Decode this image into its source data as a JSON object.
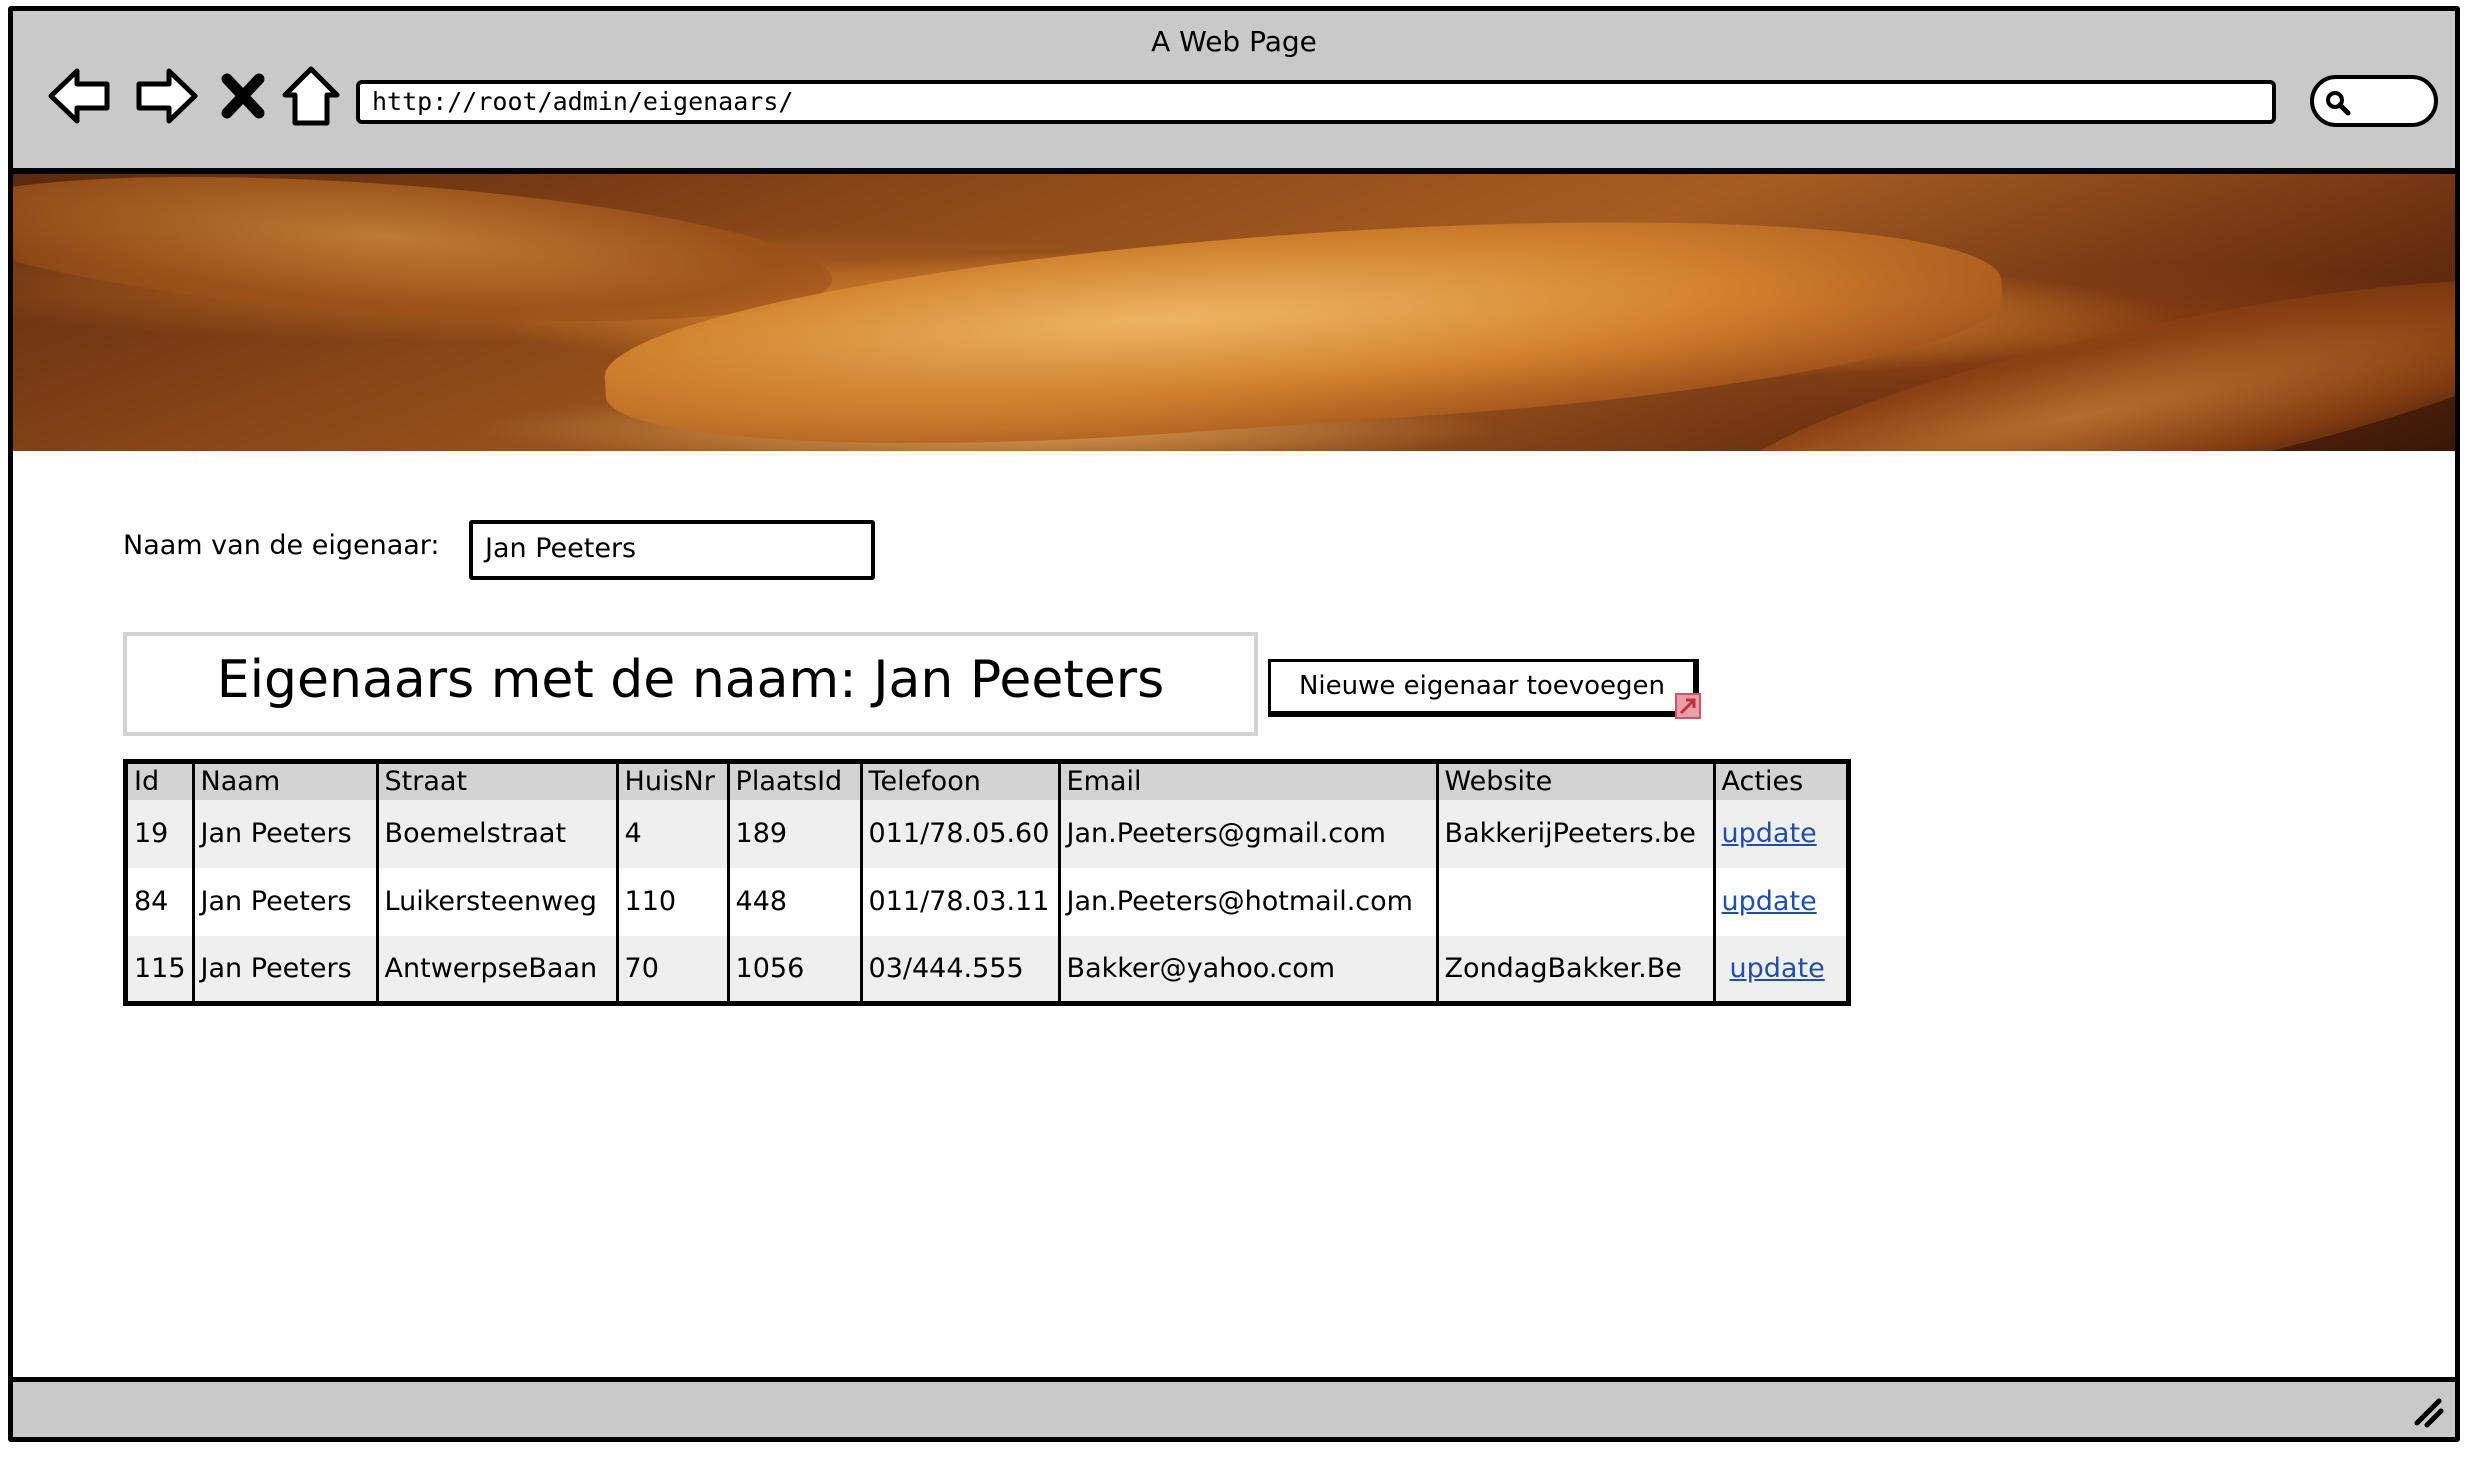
{
  "window": {
    "title": "A Web Page"
  },
  "browser": {
    "url": "http://root/admin/eigenaars/",
    "icons": [
      "back-icon",
      "forward-icon",
      "stop-icon",
      "home-icon",
      "search-icon"
    ]
  },
  "form": {
    "naam_label": "Naam van de eigenaar:",
    "naam_value": "Jan Peeters"
  },
  "heading": "Eigenaars met de naam: Jan Peeters",
  "new_button_label": "Nieuwe eigenaar toevoegen",
  "table": {
    "columns": [
      "Id",
      "Naam",
      "Straat",
      "HuisNr",
      "PlaatsId",
      "Telefoon",
      "Email",
      "Website",
      "Acties"
    ],
    "rows": [
      {
        "id": "19",
        "naam": "Jan Peeters",
        "straat": "Boemelstraat",
        "huisnr": "4",
        "plaatsid": "189",
        "telefoon": "011/78.05.60",
        "email": "Jan.Peeters@gmail.com",
        "website": "BakkerijPeeters.be",
        "actie": "update"
      },
      {
        "id": "84",
        "naam": "Jan Peeters",
        "straat": "Luikersteenweg",
        "huisnr": "110",
        "plaatsid": "448",
        "telefoon": "011/78.03.11",
        "email": "Jan.Peeters@hotmail.com",
        "website": "",
        "actie": "update"
      },
      {
        "id": "115",
        "naam": "Jan Peeters",
        "straat": "AntwerpseBaan",
        "huisnr": "70",
        "plaatsid": "1056",
        "telefoon": "03/444.555",
        "email": "Bakker@yahoo.com",
        "website": "ZondagBakker.Be",
        "actie": "update"
      }
    ]
  },
  "colors": {
    "chrome": "#c9c9c9",
    "header_row": "#d3d3d3",
    "alt_row": "#efefef",
    "link": "#1f4fa8"
  }
}
